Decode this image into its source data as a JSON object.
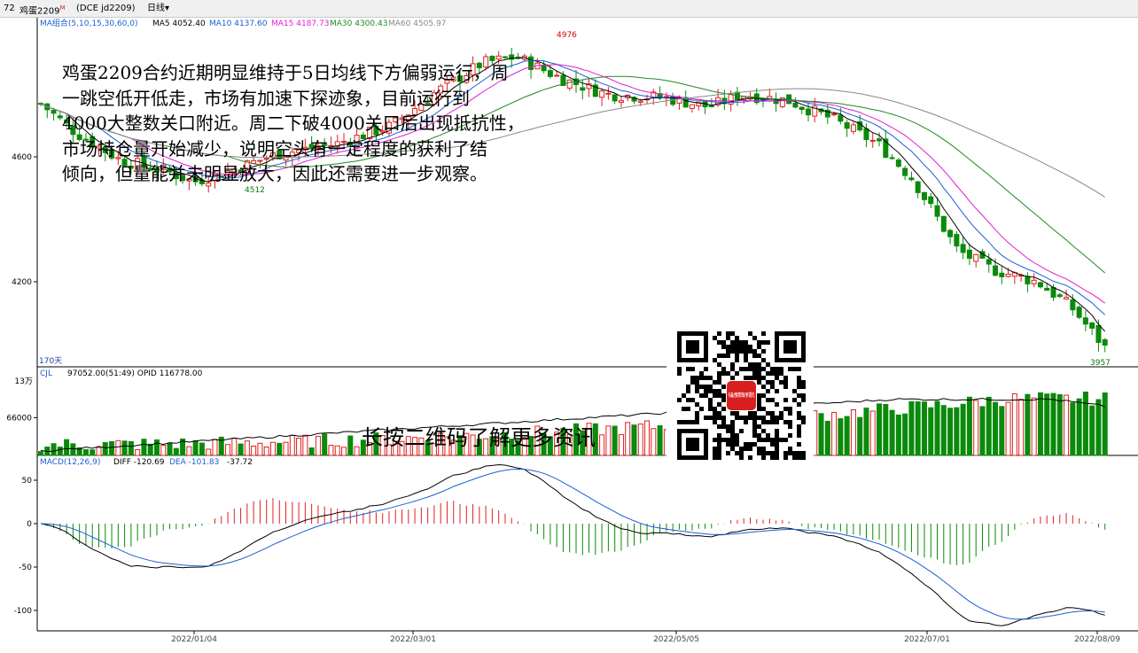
{
  "window": {
    "code": "72",
    "symbol": "鸡蛋2209",
    "market_flag": "M",
    "contract": "(DCE jd2209)",
    "period": "日线",
    "period_arrow": "▾"
  },
  "price_panel": {
    "ma_label": "MA组合(5,10,15,30,60,0)",
    "ma_items": [
      {
        "text": "MA5 4052.40",
        "color": "#000000"
      },
      {
        "text": "MA10 4137.60",
        "color": "#1a5fd6"
      },
      {
        "text": "MA15 4187.73",
        "color": "#e01fd0"
      },
      {
        "text": "MA30 4300.43",
        "color": "#1f8a1f"
      },
      {
        "text": "MA60 4505.97",
        "color": "#888888"
      }
    ],
    "y_ticks": [
      "4600",
      "4200"
    ],
    "days_label": "170天",
    "high_label": "4976",
    "low_label": "4512",
    "last_low_label": "3957"
  },
  "volume_panel": {
    "header": "CJL",
    "header_values": "97052.00(51:49)  OPID 116778.00",
    "y_top": "13万",
    "y_ticks": [
      "66000"
    ]
  },
  "macd_panel": {
    "header": "MACD(12,26,9)",
    "diff": "DIFF -120.69",
    "dea": "DEA -101.83",
    "macd": "-37.72",
    "y_ticks": [
      "50",
      "0",
      "-50",
      "-100"
    ]
  },
  "x_axis": {
    "dates": [
      "2022/01/04",
      "2022/03/01",
      "2022/05/05",
      "2022/07/01",
      "2022/08/09"
    ]
  },
  "annotation": {
    "lines": [
      "鸡蛋2209合约近期明显维持于5日均线下方偏弱运行，周",
      "一跳空低开低走，市场有加速下探迹象，目前运行到",
      "4000大整数关口附近。周二下破4000关口后出现抵抗性，",
      "市场持仓量开始减少，说明空头有一定程度的获利了结",
      "倾向，但量能并未明显放大，因此还需要进一步观察。"
    ],
    "qr_caption": "长按二维码了解更多资讯",
    "qr_logo_text": "瑞达期货研究院"
  },
  "colors": {
    "up": "#e02020",
    "down": "#0a8a0a",
    "axis": "#000000",
    "ma5": "#000000",
    "ma10": "#1a5fd6",
    "ma15": "#e01fd0",
    "ma30": "#1f8a1f",
    "ma60": "#888888"
  },
  "chart_data": [
    {
      "type": "candlestick",
      "title": "鸡蛋2209 日线",
      "ylim": [
        3957,
        4976
      ],
      "series": [
        {
          "name": "MA5",
          "last": 4052.4
        },
        {
          "name": "MA10",
          "last": 4137.6
        },
        {
          "name": "MA15",
          "last": 4187.73
        },
        {
          "name": "MA30",
          "last": 4300.43
        },
        {
          "name": "MA60",
          "last": 4505.97
        }
      ],
      "x": [
        "2022/01/04",
        "2022/03/01",
        "2022/05/05",
        "2022/07/01",
        "2022/08/09"
      ],
      "annotations": {
        "high": 4976,
        "low_early": 4512,
        "low_last": 3957
      }
    },
    {
      "type": "bar",
      "title": "CJL",
      "values_last": {
        "volume": 97052.0,
        "open_interest": 116778.0
      },
      "ylim": [
        0,
        130000
      ]
    },
    {
      "type": "line",
      "title": "MACD(12,26,9)",
      "series": [
        {
          "name": "DIFF",
          "last": -120.69
        },
        {
          "name": "DEA",
          "last": -101.83
        },
        {
          "name": "MACD",
          "last": -37.72
        }
      ],
      "ylim": [
        -120,
        70
      ]
    }
  ]
}
